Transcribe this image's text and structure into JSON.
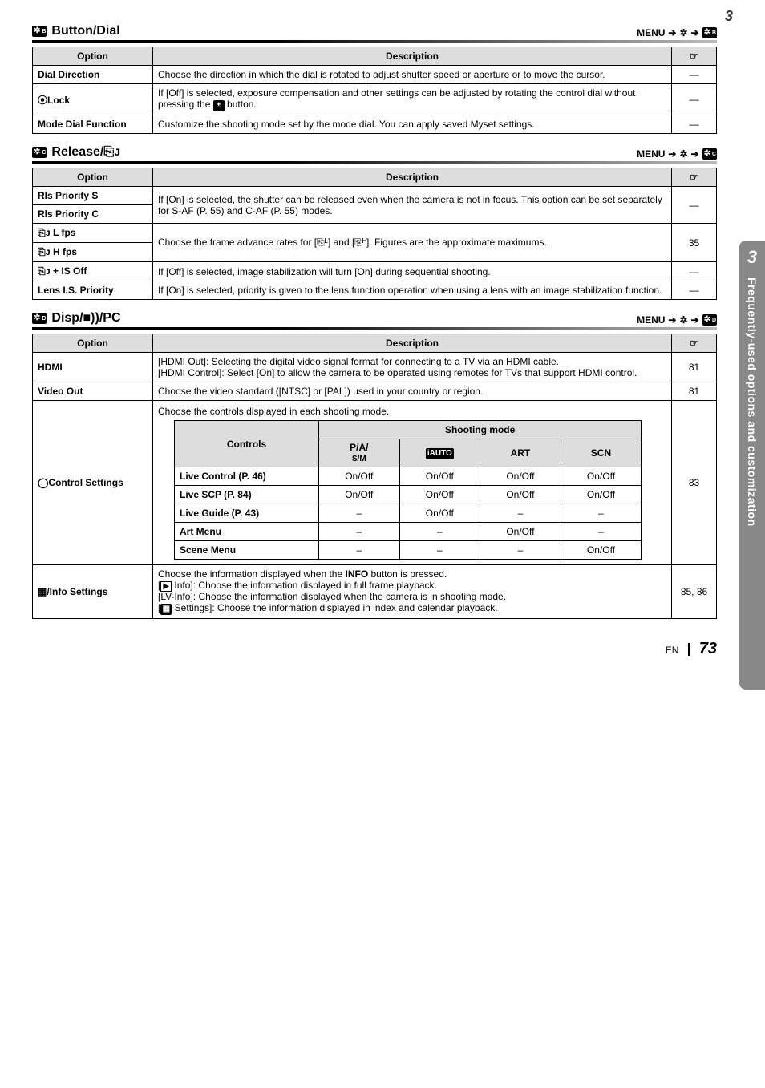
{
  "page": {
    "top_number": "3",
    "footer_lang": "EN",
    "footer_page": "73"
  },
  "side_tab": {
    "number": "3",
    "text": "Frequently-used options and customization"
  },
  "columns": {
    "option": "Option",
    "description": "Description",
    "ref_icon": "☞"
  },
  "section_button_dial": {
    "icon_letter": "B",
    "title": "Button/Dial",
    "menu_prefix": "MENU",
    "menu_icon_letter": "B",
    "rows": [
      {
        "option": "Dial Direction",
        "desc": "Choose the direction in which the dial is rotated to adjust shutter speed or aperture or to move the cursor.",
        "ref": "—"
      },
      {
        "option": "⦿Lock",
        "desc_pre": "If [Off] is selected, exposure compensation and other settings can be adjusted by rotating the control dial without pressing the ",
        "desc_btn": "±",
        "desc_post": " button.",
        "ref": "—"
      },
      {
        "option": "Mode Dial Function",
        "desc": "Customize the shooting mode set by the mode dial. You can apply saved Myset settings.",
        "ref": "—"
      }
    ]
  },
  "section_release": {
    "icon_letter": "C",
    "title": "Release/⎘ᴊ",
    "menu_prefix": "MENU",
    "menu_icon_letter": "C",
    "rows": {
      "rls_s": "Rls Priority S",
      "rls_c": "Rls Priority C",
      "rls_desc": "If [On] is selected, the shutter can be released even when the camera is not in focus. This option can be set separately for S-AF (P. 55) and C-AF (P. 55) modes.",
      "rls_ref": "—",
      "lfps": "⎘ᴊ L fps",
      "hfps": "⎘ᴊ H fps",
      "fps_desc_pre": "Choose the frame advance rates for [",
      "fps_desc_mid": "] and [",
      "fps_desc_post": "]. Figures are the approximate maximums.",
      "fps_icon_l": "⎘ᴸ",
      "fps_icon_h": "⎘ᴴ",
      "fps_ref": "35",
      "isoff": "⎘ᴊ + IS Off",
      "isoff_desc": "If [Off] is selected, image stabilization will turn [On] during sequential shooting.",
      "isoff_ref": "—",
      "lens": "Lens I.S. Priority",
      "lens_desc": "If [On] is selected, priority is given to the lens function operation when using a lens with an image stabilization function.",
      "lens_ref": "—"
    }
  },
  "section_disp": {
    "icon_letter": "D",
    "title": "Disp/■))/PC",
    "menu_prefix": "MENU",
    "menu_icon_letter": "D",
    "rows": {
      "hdmi_opt": "HDMI",
      "hdmi_desc": "[HDMI Out]: Selecting the digital video signal format for connecting to a TV via an HDMI cable.\n[HDMI Control]: Select [On] to allow the camera to be operated using remotes for TVs that support HDMI control.",
      "hdmi_ref": "81",
      "video_opt": "Video Out",
      "video_desc": "Choose the video standard ([NTSC] or [PAL]) used in your country or region.",
      "video_ref": "81",
      "ctrl_opt": "◯Control Settings",
      "ctrl_desc": "Choose the controls displayed in each shooting mode.",
      "ctrl_ref": "83",
      "ctrl_table": {
        "head_controls": "Controls",
        "head_mode": "Shooting mode",
        "mode_pa": "P/A/",
        "mode_sm": "S/M",
        "mode_iauto": "iAUTO",
        "mode_art": "ART",
        "mode_scn": "SCN",
        "r1": {
          "label": "Live Control (P. 46)",
          "c1": "On/Off",
          "c2": "On/Off",
          "c3": "On/Off",
          "c4": "On/Off"
        },
        "r2": {
          "label": "Live SCP (P. 84)",
          "c1": "On/Off",
          "c2": "On/Off",
          "c3": "On/Off",
          "c4": "On/Off"
        },
        "r3": {
          "label": "Live Guide (P. 43)",
          "c1": "–",
          "c2": "On/Off",
          "c3": "–",
          "c4": "–"
        },
        "r4": {
          "label": "Art Menu",
          "c1": "–",
          "c2": "–",
          "c3": "On/Off",
          "c4": "–"
        },
        "r5": {
          "label": "Scene Menu",
          "c1": "–",
          "c2": "–",
          "c3": "–",
          "c4": "On/Off"
        }
      },
      "info_opt": "▦/Info Settings",
      "info_desc_1": "Choose the information displayed when the ",
      "info_btn": "INFO",
      "info_desc_2": " button is pressed.",
      "info_line2_pre": "[",
      "info_line2_icon": "▶",
      "info_line2_post": " Info]: Choose the information displayed in full frame playback.",
      "info_line3": "[LV-Info]: Choose the information displayed when the camera is in shooting mode.",
      "info_line4_pre": "[",
      "info_line4_icon": "▦",
      "info_line4_post": " Settings]: Choose the information displayed in index and calendar playback.",
      "info_ref": "85, 86"
    }
  }
}
